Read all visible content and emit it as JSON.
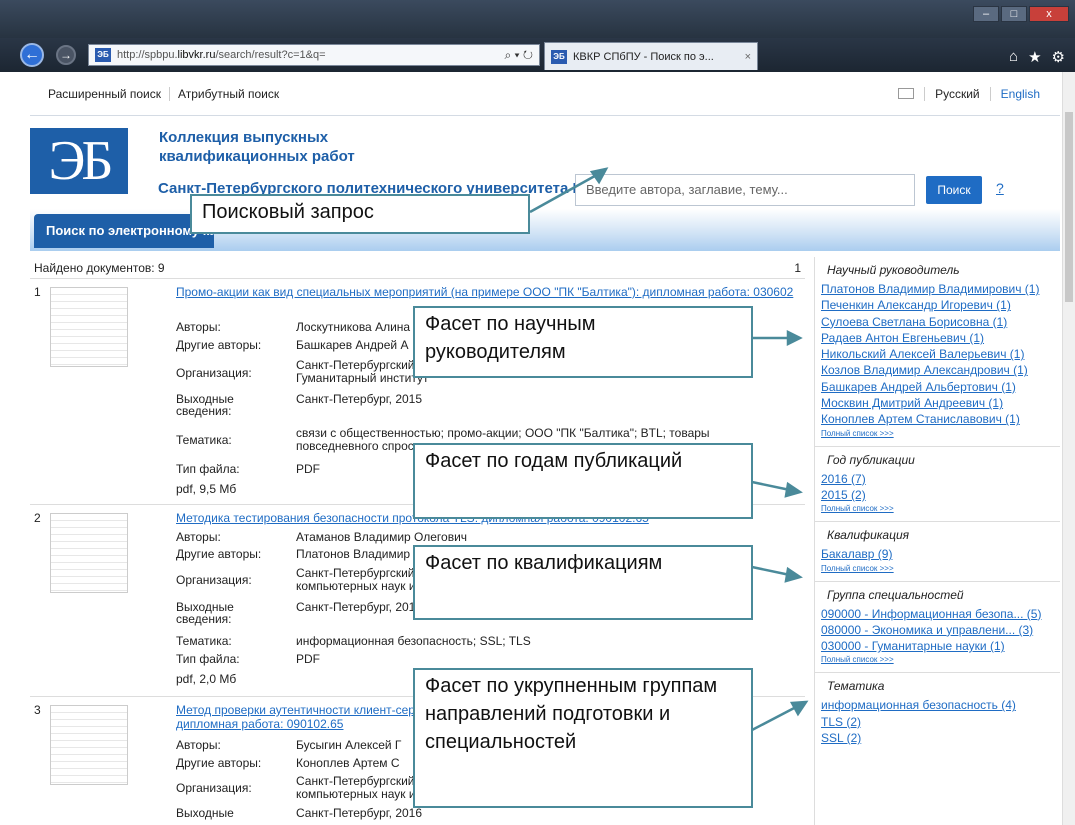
{
  "browser": {
    "url_prefix": "http://spbpu.",
    "url_host": "libvkr.ru",
    "url_rest": "/search/result?c=1&q=",
    "url_tools": "⌕ ▾ ↻",
    "favicon": "ЭБ",
    "tab_title": "КВКР СПбПУ - Поиск по э...",
    "tab_close": "×",
    "back": "←",
    "forward": "→",
    "win_min": "–",
    "win_max": "□",
    "win_close": "x"
  },
  "topnav": {
    "advanced": "Расширенный поиск",
    "attribute": "Атрибутный поиск",
    "lang_ru": "Русский",
    "lang_en": "English"
  },
  "header": {
    "logo": "ЭБ",
    "title_line1": "Коллекция выпускных",
    "title_line2": "квалификационных работ",
    "university": "Санкт-Петербургского политехнического университета Петра Великого",
    "search_placeholder": "Введите автора, заглавие, тему...",
    "search_button": "Поиск",
    "help": "?",
    "tab": "Поиск по электронному каталогу"
  },
  "results": {
    "found": "Найдено документов: 9",
    "page": "1",
    "items": [
      {
        "num": "1",
        "title": "Промо-акции как вид специальных мероприятий (на примере ООО \"ПК \"Балтика\"): дипломная работа: 030602",
        "rows": [
          {
            "label": "Авторы:",
            "value": "Лоскутникова Алина"
          },
          {
            "label": "Другие авторы:",
            "value": "Башкарев Андрей А"
          },
          {
            "label": "Организация:",
            "value": "Санкт-Петербургский политехнический университет Петра Великого",
            "value2": "Гуманитарный институт"
          },
          {
            "label": "Выходные",
            "label2": "сведения:",
            "value": "Санкт-Петербург, 2015"
          },
          {
            "label": "Тематика:",
            "value": "связи с общественностью; промо-акции; ООО \"ПК \"Балтика\"; BTL; товары",
            "value2": "повседневного спроса"
          },
          {
            "label": "Тип файла:",
            "value": "PDF"
          },
          {
            "label": "pdf, 9,5 Мб",
            "value": ""
          }
        ]
      },
      {
        "num": "2",
        "title": "Методика тестирования безопасности протокола TLS: дипломная работа: 090102.65",
        "rows": [
          {
            "label": "Авторы:",
            "value": "Атаманов Владимир Олегович"
          },
          {
            "label": "Другие авторы:",
            "value": "Платонов Владимир Владимирович"
          },
          {
            "label": "Организация:",
            "value": "Санкт-Петербургский политехнический университет Петра Великого",
            "value2": "компьютерных наук и технологий"
          },
          {
            "label": "Выходные",
            "label2": "сведения:",
            "value": "Санкт-Петербург, 2016"
          },
          {
            "label": "Тематика:",
            "value": "информационная безопасность; SSL; TLS"
          },
          {
            "label": "Тип файла:",
            "value": "PDF"
          },
          {
            "label": "pdf, 2,0 Мб",
            "value": ""
          }
        ]
      },
      {
        "num": "3",
        "title": "Метод проверки аутентичности клиент-серверного взаимодействия",
        "title2": "дипломная работа: 090102.65",
        "rows": [
          {
            "label": "Авторы:",
            "value": "Бусыгин Алексей Г"
          },
          {
            "label": "Другие авторы:",
            "value": "Коноплев Артем С"
          },
          {
            "label": "Организация:",
            "value": "Санкт-Петербургский политехнический университет Петра Великого",
            "value2": "компьютерных наук и технологий"
          },
          {
            "label": "Выходные",
            "value": "Санкт-Петербург, 2016"
          }
        ]
      }
    ]
  },
  "facets": [
    {
      "heading": "Научный руководитель",
      "items": [
        "Платонов Владимир Владимирович (1)",
        "Печенкин Александр Игоревич (1)",
        "Сулоева Светлана Борисовна (1)",
        "Радаев Антон Евгеньевич (1)",
        "Никольский Алексей Валерьевич (1)",
        "Козлов Владимир Александрович (1)",
        "Башкарев Андрей Альбертович (1)",
        "Москвин Дмитрий Андреевич (1)",
        "Коноплев Артем Станиславович (1)"
      ],
      "full": "Полный список >>>"
    },
    {
      "heading": "Год публикации",
      "items": [
        "2016 (7)",
        "2015 (2)"
      ],
      "full": "Полный список >>>"
    },
    {
      "heading": "Квалификация",
      "items": [
        "Бакалавр (9)"
      ],
      "full": "Полный список >>>"
    },
    {
      "heading": "Группа специальностей",
      "items": [
        "090000 - Информационная безопа... (5)",
        "080000 - Экономика и управлени... (3)",
        "030000 - Гуманитарные науки (1)"
      ],
      "full": "Полный список >>>"
    },
    {
      "heading": "Тематика",
      "items": [
        "информационная безопасность (4)",
        "TLS (2)",
        "SSL (2)"
      ],
      "full": ""
    }
  ],
  "annotations": {
    "query": "Поисковый запрос",
    "supervisors": "Фасет по научным руководителям",
    "years": "Фасет по годам публикаций",
    "qualifications": "Фасет по квалификациям",
    "groups": "Фасет по укрупненным группам направлений подготовки и специальностей"
  }
}
